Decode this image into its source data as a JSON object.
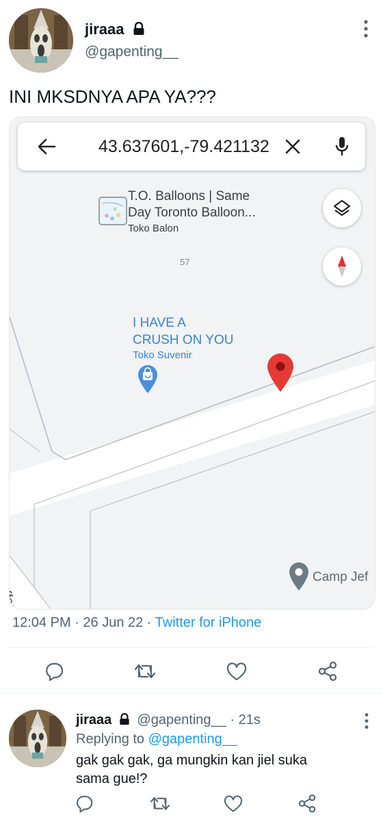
{
  "tweet": {
    "author_name": "jiraaa",
    "author_handle": "@gapenting__",
    "text": "INI MKSDNYA APA YA???",
    "time": "12:04 PM",
    "date": "26 Jun 22",
    "source": "Twitter for iPhone",
    "meta_sep": " · "
  },
  "map": {
    "coordinates": "43.637601,-79.421132",
    "poi_balloons_title_line1": "T.O. Balloons | Same",
    "poi_balloons_title_line2": "Day Toronto Balloon...",
    "poi_balloons_category": "Toko Balon",
    "building_number": "57",
    "poi_crush_line1": "I HAVE A",
    "poi_crush_line2": "CRUSH ON YOU",
    "poi_crush_category": "Toko Suvenir",
    "poi_camp": "Camp Jef",
    "street_label": "Jeffer"
  },
  "reply": {
    "author_name": "jiraaa",
    "author_handle": "@gapenting__",
    "age": "21s",
    "sep": " · ",
    "replying_prefix": "Replying to",
    "replying_handle": "@gapenting__",
    "text_line1": "gak gak gak, ga mungkin kan jiel suka",
    "text_line2": "sama gue!?"
  },
  "icons": {
    "lock": "lock-icon",
    "more": "more-vertical-icon",
    "back": "back-arrow-icon",
    "clear": "close-icon",
    "mic": "microphone-icon",
    "layers": "layers-icon",
    "compass": "compass-icon",
    "reply": "reply-icon",
    "retweet": "retweet-icon",
    "like": "heart-icon",
    "share": "share-icon"
  },
  "colors": {
    "link": "#1d9bf0",
    "map_poi_blue": "#3b83d3",
    "map_pin_red": "#d93025",
    "secondary_text": "#536471"
  }
}
